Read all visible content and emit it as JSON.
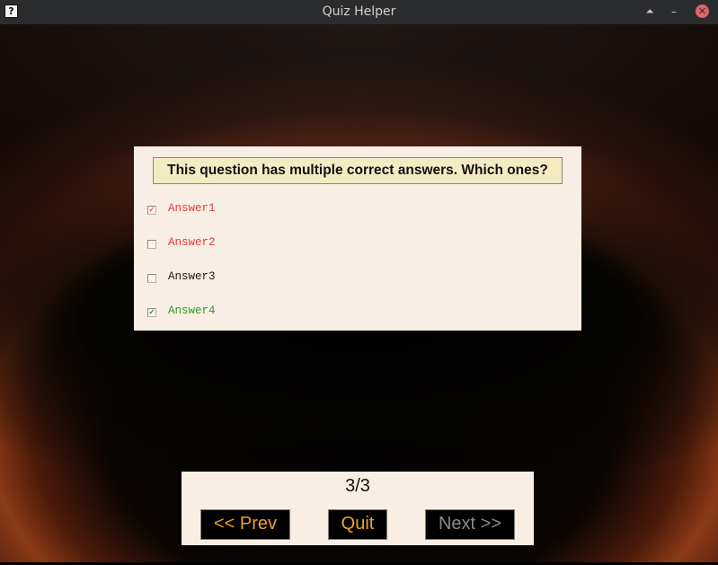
{
  "window": {
    "title": "Quiz Helper",
    "app_icon": "?",
    "buttons": {
      "maximize": "⏶",
      "minimize": "–",
      "close": "✕"
    }
  },
  "question": {
    "text": "This question has multiple correct answers. Which ones?",
    "answers": [
      {
        "label": "Answer1",
        "checked": true,
        "color": "#e8393a",
        "check_color": "#d62a2a"
      },
      {
        "label": "Answer2",
        "checked": false,
        "color": "#e8393a",
        "check_color": ""
      },
      {
        "label": "Answer3",
        "checked": false,
        "color": "#1a1a1a",
        "check_color": ""
      },
      {
        "label": "Answer4",
        "checked": true,
        "color": "#2a9a2a",
        "check_color": "#1b6b1b"
      }
    ]
  },
  "pager": {
    "counter": "3/3",
    "prev_label": "<< Prev",
    "quit_label": "Quit",
    "next_label": "Next >>"
  }
}
